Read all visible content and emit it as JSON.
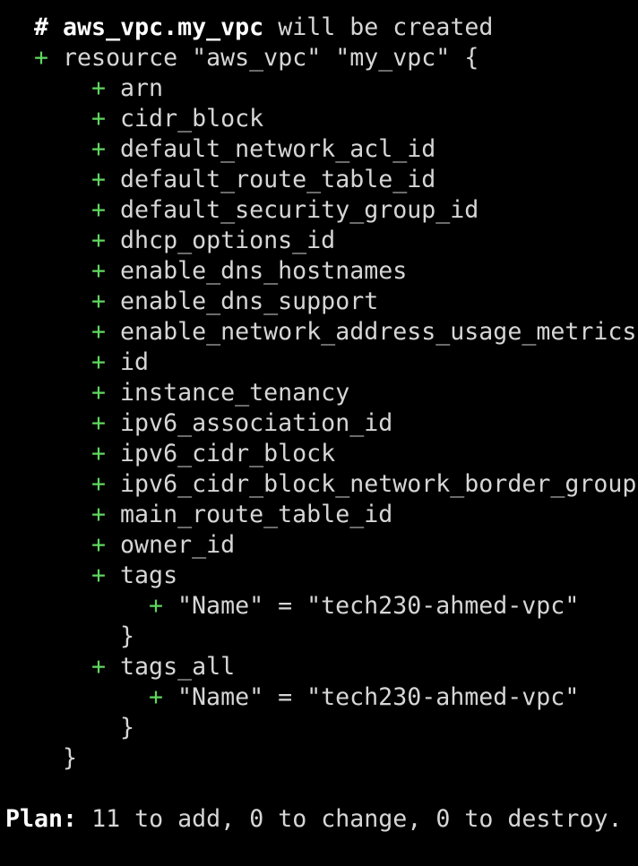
{
  "plan_output": {
    "comment": {
      "hash": "#",
      "resource_address": "aws_vpc.my_vpc",
      "action_text": "will be created"
    },
    "resource_header": {
      "plus": "+",
      "text": "resource \"aws_vpc\" \"my_vpc\" {"
    },
    "attributes": [
      {
        "plus": "+",
        "name": "arn"
      },
      {
        "plus": "+",
        "name": "cidr_block"
      },
      {
        "plus": "+",
        "name": "default_network_acl_id"
      },
      {
        "plus": "+",
        "name": "default_route_table_id"
      },
      {
        "plus": "+",
        "name": "default_security_group_id"
      },
      {
        "plus": "+",
        "name": "dhcp_options_id"
      },
      {
        "plus": "+",
        "name": "enable_dns_hostnames"
      },
      {
        "plus": "+",
        "name": "enable_dns_support"
      },
      {
        "plus": "+",
        "name": "enable_network_address_usage_metrics"
      },
      {
        "plus": "+",
        "name": "id"
      },
      {
        "plus": "+",
        "name": "instance_tenancy"
      },
      {
        "plus": "+",
        "name": "ipv6_association_id"
      },
      {
        "plus": "+",
        "name": "ipv6_cidr_block"
      },
      {
        "plus": "+",
        "name": "ipv6_cidr_block_network_border_group"
      },
      {
        "plus": "+",
        "name": "main_route_table_id"
      },
      {
        "plus": "+",
        "name": "owner_id"
      },
      {
        "plus": "+",
        "name": "tags"
      }
    ],
    "tags_entry": {
      "plus": "+",
      "text": "\"Name\" = \"tech230-ahmed-vpc\""
    },
    "tags_close": "}",
    "tags_all": {
      "plus": "+",
      "name": "tags_all"
    },
    "tags_all_entry": {
      "plus": "+",
      "text": "\"Name\" = \"tech230-ahmed-vpc\""
    },
    "tags_all_close": "}",
    "resource_close": "}",
    "summary": {
      "label": "Plan:",
      "text": "11 to add, 0 to change, 0 to destroy."
    }
  },
  "colors": {
    "background": "#000000",
    "text": "#d6d6d6",
    "plus": "#5fd75f",
    "bold": "#ffffff"
  }
}
